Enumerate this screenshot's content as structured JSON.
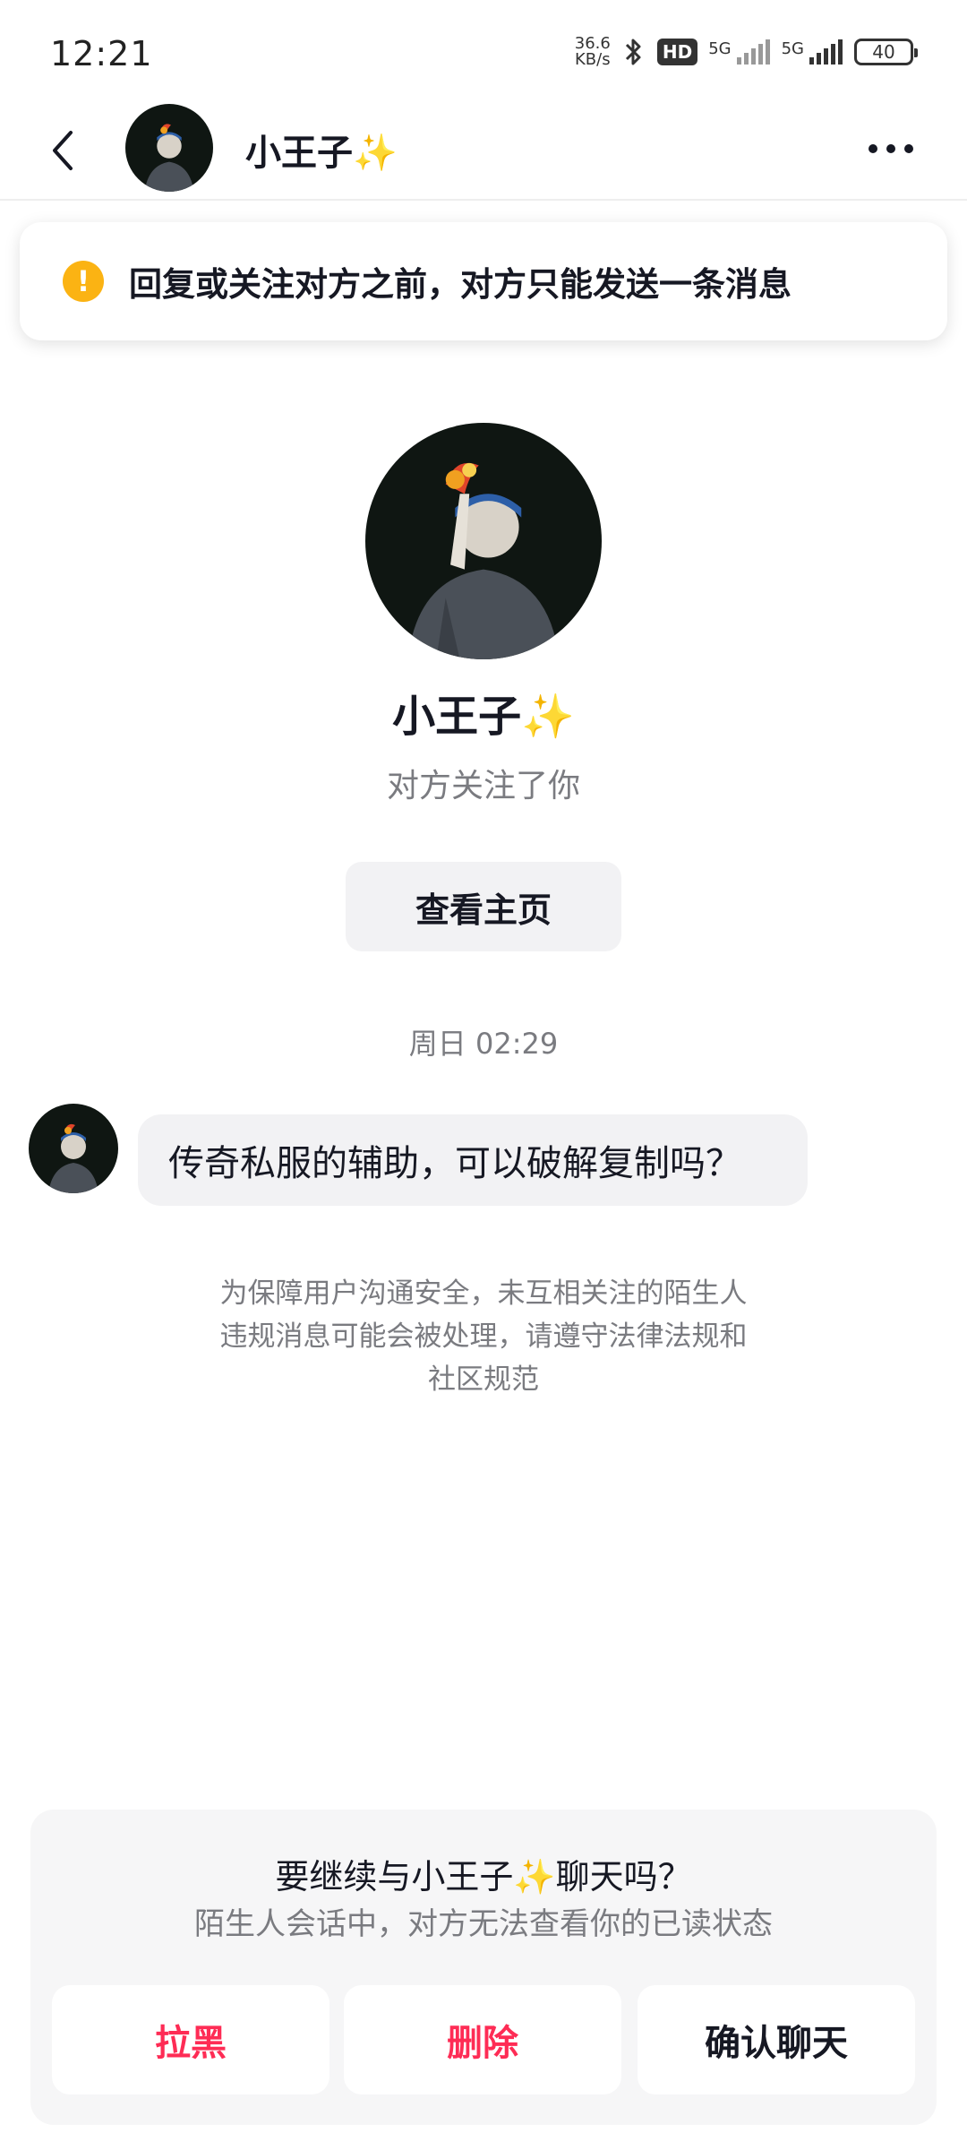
{
  "status_bar": {
    "time": "12:21",
    "net_speed_value": "36.6",
    "net_speed_unit": "KB/s",
    "hd_label": "HD",
    "signal1_label": "5G",
    "signal2_label": "5G",
    "battery": "40"
  },
  "header": {
    "title": "小王子✨"
  },
  "notice": {
    "icon_glyph": "!",
    "text": "回复或关注对方之前，对方只能发送一条消息"
  },
  "profile": {
    "name": "小王子✨",
    "subtitle": "对方关注了你",
    "view_home_label": "查看主页"
  },
  "chat": {
    "timestamp": "周日 02:29",
    "message": "传奇私服的辅助，可以破解复制吗？"
  },
  "safety_note": {
    "line1": "为保障用户沟通安全，未互相关注的陌生人",
    "line2": "违规消息可能会被处理，请遵守法律法规和",
    "line3": "社区规范"
  },
  "bottom_panel": {
    "title": "要继续与小王子✨聊天吗？",
    "subtitle": "陌生人会话中，对方无法查看你的已读状态",
    "block_label": "拉黑",
    "delete_label": "删除",
    "confirm_label": "确认聊天"
  },
  "colors": {
    "accent_red": "#fe2c55",
    "warning_yellow": "#fbb313",
    "text_primary": "#161823",
    "text_secondary": "#7a7b80"
  }
}
